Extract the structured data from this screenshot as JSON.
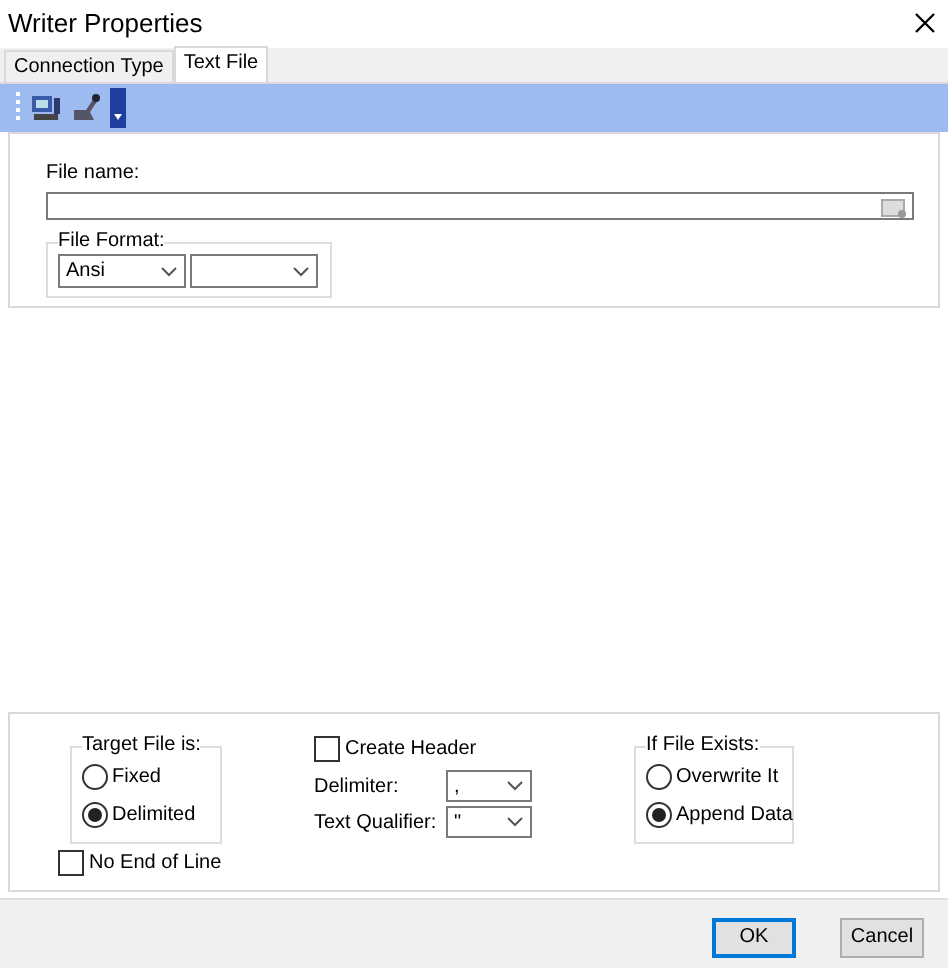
{
  "window": {
    "title": "Writer Properties"
  },
  "tabs": [
    {
      "label": "Connection Type",
      "selected": false
    },
    {
      "label": "Text File",
      "selected": true
    }
  ],
  "file_name": {
    "label": "File name:"
  },
  "file_format": {
    "label": "File Format:",
    "encoding": "Ansi"
  },
  "target_file": {
    "label": "Target File is:",
    "options": [
      {
        "label": "Fixed",
        "selected": false
      },
      {
        "label": "Delimited",
        "selected": true
      }
    ]
  },
  "no_end_of_line": {
    "label": "No End of Line",
    "checked": false
  },
  "create_header": {
    "label": "Create Header",
    "checked": false
  },
  "delimiter": {
    "label": "Delimiter:",
    "value": ","
  },
  "text_qualifier": {
    "label": "Text Qualifier:",
    "value": "\""
  },
  "if_file_exists": {
    "label": "If File Exists:",
    "options": [
      {
        "label": "Overwrite It",
        "selected": false
      },
      {
        "label": "Append Data",
        "selected": true
      }
    ]
  },
  "buttons": [
    {
      "label": "OK",
      "default": true
    },
    {
      "label": "Cancel",
      "default": false
    }
  ]
}
